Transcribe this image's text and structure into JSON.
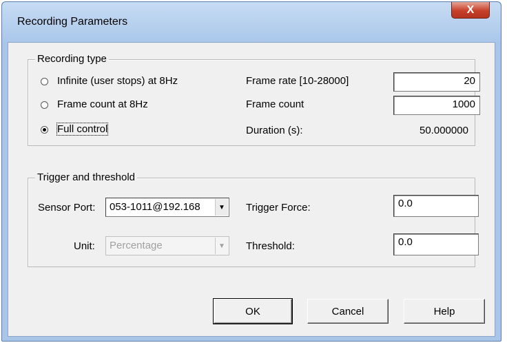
{
  "window": {
    "title": "Recording Parameters",
    "close_glyph": "X"
  },
  "recording_type": {
    "legend": "Recording type",
    "options": [
      {
        "label": "Infinite (user stops) at 8Hz",
        "selected": false
      },
      {
        "label": "Frame count at 8Hz",
        "selected": false
      },
      {
        "label": "Full control",
        "selected": true
      }
    ],
    "frame_rate_label": "Frame rate [10-28000]",
    "frame_rate_value": "20",
    "frame_count_label": "Frame count",
    "frame_count_value": "1000",
    "duration_label": "Duration (s):",
    "duration_value": "50.000000"
  },
  "trigger": {
    "legend": "Trigger and threshold",
    "sensor_port_label": "Sensor Port:",
    "sensor_port_value": "053-1011@192.168",
    "unit_label": "Unit:",
    "unit_value": "Percentage",
    "trigger_force_label": "Trigger Force:",
    "trigger_force_value": "0.0",
    "threshold_label": "Threshold:",
    "threshold_value": "0.0"
  },
  "buttons": {
    "ok": "OK",
    "cancel": "Cancel",
    "help": "Help"
  },
  "icons": {
    "radio": "radio-button-icon",
    "dropdown": "chevron-down-icon",
    "close": "close-icon"
  },
  "colors": {
    "title_bar": "#aac7ea",
    "close_button": "#c5402a",
    "dialog_bg": "#f0f0f0"
  }
}
